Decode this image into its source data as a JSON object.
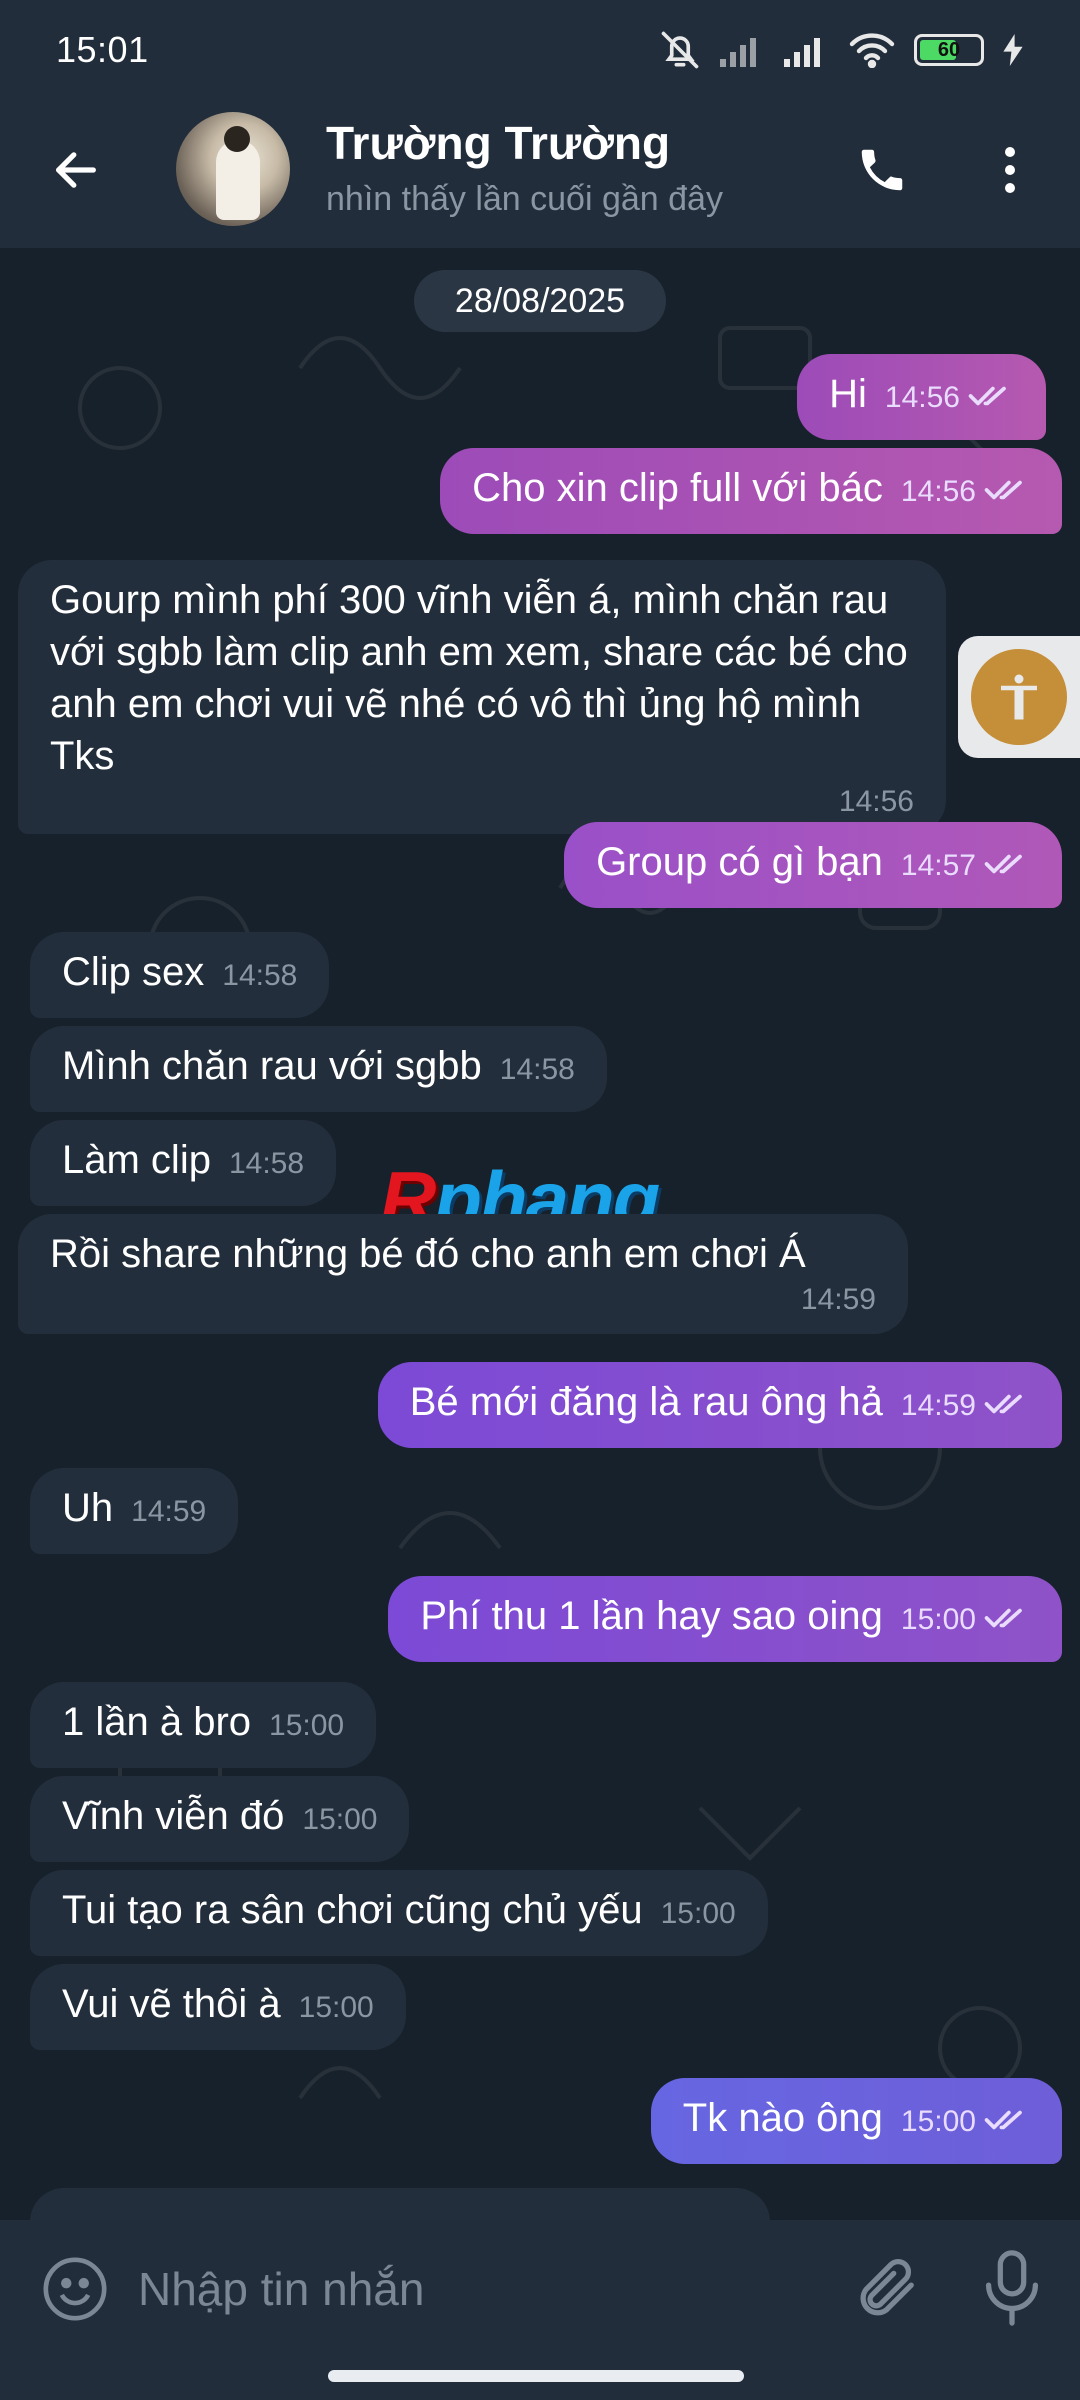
{
  "status_bar": {
    "time": "15:01",
    "battery": "60",
    "battery_level": 0.6
  },
  "header": {
    "name": "Trường Trường",
    "status": "nhìn thấy lần cuối gần đây"
  },
  "chat": {
    "date": "28/08/2025",
    "messages": [
      {
        "dir": "out",
        "text": "Hi",
        "time": "14:56"
      },
      {
        "dir": "out",
        "text": "Cho xin clip full với bác",
        "time": "14:56"
      },
      {
        "dir": "in",
        "text": "Gourp mình phí 300 vĩnh viễn á, mình chăn rau với sgbb làm clip anh em xem, share các bé cho anh em chơi vui vẽ nhé có vô thì ủng hộ mình Tks",
        "time": "14:56"
      },
      {
        "dir": "out",
        "text": "Group có gì bạn",
        "time": "14:57"
      },
      {
        "dir": "in",
        "text": "Clip sex",
        "time": "14:58"
      },
      {
        "dir": "in",
        "text": "Mình chăn rau với sgbb",
        "time": "14:58"
      },
      {
        "dir": "in",
        "text": "Làm clip",
        "time": "14:58"
      },
      {
        "dir": "in",
        "text": "Rồi share những bé đó cho anh em chơi Á",
        "time": "14:59"
      },
      {
        "dir": "out",
        "text": "Bé mới đăng là rau ông hả",
        "time": "14:59"
      },
      {
        "dir": "in",
        "text": "Uh",
        "time": "14:59"
      },
      {
        "dir": "out",
        "text": "Phí thu 1 lần hay sao oing",
        "time": "15:00"
      },
      {
        "dir": "in",
        "text": "1 lần à bro",
        "time": "15:00"
      },
      {
        "dir": "in",
        "text": "Vĩnh viễn đó",
        "time": "15:00"
      },
      {
        "dir": "in",
        "text": "Tui tạo ra sân chơi cũng chủ yếu",
        "time": "15:00"
      },
      {
        "dir": "in",
        "text": "Vui vẽ thôi à",
        "time": "15:00"
      },
      {
        "dir": "out",
        "text": "Tk nào ông",
        "time": "15:00"
      }
    ]
  },
  "watermark": {
    "first": "R",
    "rest": "phang"
  },
  "input": {
    "placeholder": "Nhập tin nhắn"
  },
  "colors": {
    "header_bg": "#212d3b",
    "chat_bg": "#17212b",
    "incoming_bubble": "#232e3c",
    "outgoing_pink": "#a552b6",
    "outgoing_purple": "#7a4fd6",
    "outgoing_blue": "#6a61e0"
  },
  "icons": {
    "back": "arrow-left-icon",
    "call": "phone-icon",
    "menu": "more-vertical-icon",
    "emoji": "smiley-icon",
    "attach": "paperclip-icon",
    "mic": "microphone-icon",
    "accessibility": "accessibility-icon"
  }
}
